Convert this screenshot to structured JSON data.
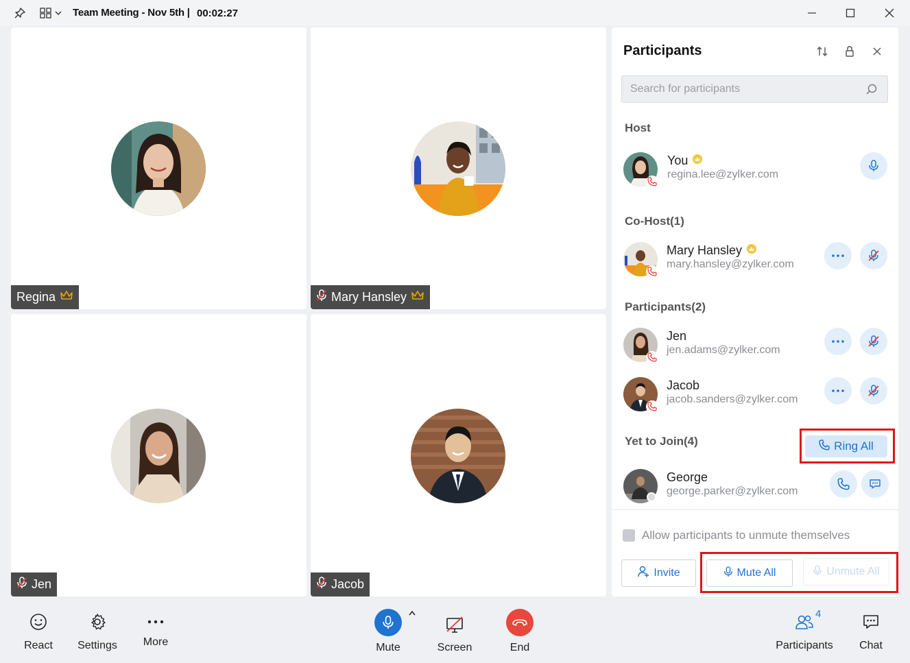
{
  "titlebar": {
    "title": "Team Meeting - Nov 5th |",
    "timer": "00:02:27"
  },
  "tiles": [
    {
      "name": "Regina",
      "muted": false,
      "crown": true
    },
    {
      "name": "Mary Hansley",
      "muted": true,
      "crown": true
    },
    {
      "name": "Jen",
      "muted": true,
      "crown": false
    },
    {
      "name": "Jacob",
      "muted": true,
      "crown": false
    }
  ],
  "panel": {
    "title": "Participants",
    "search_placeholder": "Search for participants",
    "host_section": "Host",
    "cohost_section": "Co-Host(1)",
    "participants_section": "Participants(2)",
    "yet_to_join_section": "Yet to Join(4)",
    "ring_all": "Ring All",
    "allow_unmute": "Allow participants to unmute themselves",
    "invite": "Invite",
    "mute_all": "Mute All",
    "unmute_all": "Unmute All"
  },
  "host": {
    "name": "You",
    "email": "regina.lee@zylker.com"
  },
  "cohost": {
    "name": "Mary Hansley",
    "email": "mary.hansley@zylker.com"
  },
  "participants": [
    {
      "name": "Jen",
      "email": "jen.adams@zylker.com"
    },
    {
      "name": "Jacob",
      "email": "jacob.sanders@zylker.com"
    }
  ],
  "yet_to_join": [
    {
      "name": "George",
      "email": "george.parker@zylker.com"
    }
  ],
  "bottombar": {
    "react": "React",
    "settings": "Settings",
    "more": "More",
    "mute": "Mute",
    "screen": "Screen",
    "end": "End",
    "participants": "Participants",
    "participants_count": "4",
    "chat": "Chat"
  },
  "colors": {
    "accent": "#1f73d1",
    "end_red": "#e8473c",
    "highlight": "#e0151b",
    "name_tag_bg": "#4a4a4a",
    "crown": "#e8a800"
  }
}
